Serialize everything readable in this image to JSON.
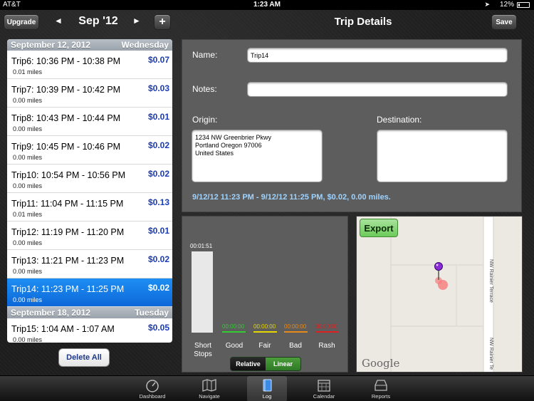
{
  "status": {
    "carrier": "AT&T",
    "time": "1:23 AM",
    "battery": "12%"
  },
  "toolbar": {
    "upgrade_label": "Upgrade",
    "month_label": "Sep '12",
    "prev_arrow": "◄",
    "next_arrow": "►",
    "add_label": "+",
    "title": "Trip Details",
    "save_label": "Save"
  },
  "trips": {
    "sections": [
      {
        "date": "September 12, 2012",
        "day": "Wednesday",
        "items": [
          {
            "title": "Trip6: 10:36 PM - 10:38 PM",
            "miles": "0.01 miles",
            "cost": "$0.07"
          },
          {
            "title": "Trip7: 10:39 PM - 10:42 PM",
            "miles": "0.00 miles",
            "cost": "$0.03"
          },
          {
            "title": "Trip8: 10:43 PM - 10:44 PM",
            "miles": "0.00 miles",
            "cost": "$0.01"
          },
          {
            "title": "Trip9: 10:45 PM - 10:46 PM",
            "miles": "0.00 miles",
            "cost": "$0.02"
          },
          {
            "title": "Trip10: 10:54 PM - 10:56 PM",
            "miles": "0.00 miles",
            "cost": "$0.02"
          },
          {
            "title": "Trip11: 11:04 PM - 11:15 PM",
            "miles": "0.01 miles",
            "cost": "$0.13"
          },
          {
            "title": "Trip12: 11:19 PM - 11:20 PM",
            "miles": "0.00 miles",
            "cost": "$0.01"
          },
          {
            "title": "Trip13: 11:21 PM - 11:23 PM",
            "miles": "0.00 miles",
            "cost": "$0.02"
          },
          {
            "title": "Trip14: 11:23 PM - 11:25 PM",
            "miles": "0.00 miles",
            "cost": "$0.02",
            "selected": true
          }
        ]
      },
      {
        "date": "September 18, 2012",
        "day": "Tuesday",
        "items": [
          {
            "title": "Trip15: 1:04 AM - 1:07 AM",
            "miles": "0.00 miles",
            "cost": "$0.05"
          }
        ]
      }
    ],
    "delete_all_label": "Delete All"
  },
  "details": {
    "name_label": "Name:",
    "name_value": "Trip14",
    "notes_label": "Notes:",
    "notes_value": "",
    "origin_label": "Origin:",
    "origin_lines": [
      "1234  NW Greenbrier Pkwy",
      "Portland Oregon 97006",
      "United States"
    ],
    "destination_label": "Destination:",
    "destination_value": "",
    "summary": "9/12/12 11:23 PM - 9/12/12 11:25 PM, $0.02, 0.00 miles."
  },
  "stats": {
    "short_stops_value": "00:01:51",
    "short_stops_label_1": "Short",
    "short_stops_label_2": "Stops",
    "short_stops_fill": 1.0,
    "good": {
      "label": "Good",
      "value": "00:00:00",
      "color": "#33cc33"
    },
    "fair": {
      "label": "Fair",
      "value": "00:00:00",
      "color": "#e6d600"
    },
    "bad": {
      "label": "Bad",
      "value": "00:00:00",
      "color": "#e88a1a"
    },
    "rash": {
      "label": "Rash",
      "value": "00:00:00",
      "color": "#e02020"
    },
    "relative_label": "Relative",
    "linear_label": "Linear"
  },
  "map": {
    "export_label": "Export",
    "street_1": "NW Rainier Terrace",
    "street_2": "NW Rainier Te",
    "brand": "Google"
  },
  "tabs": [
    {
      "label": "Dashboard",
      "icon": "gauge-icon"
    },
    {
      "label": "Navigate",
      "icon": "map-icon"
    },
    {
      "label": "Log",
      "icon": "log-icon",
      "active": true
    },
    {
      "label": "Calendar",
      "icon": "calendar-icon"
    },
    {
      "label": "Reports",
      "icon": "reports-icon"
    }
  ]
}
